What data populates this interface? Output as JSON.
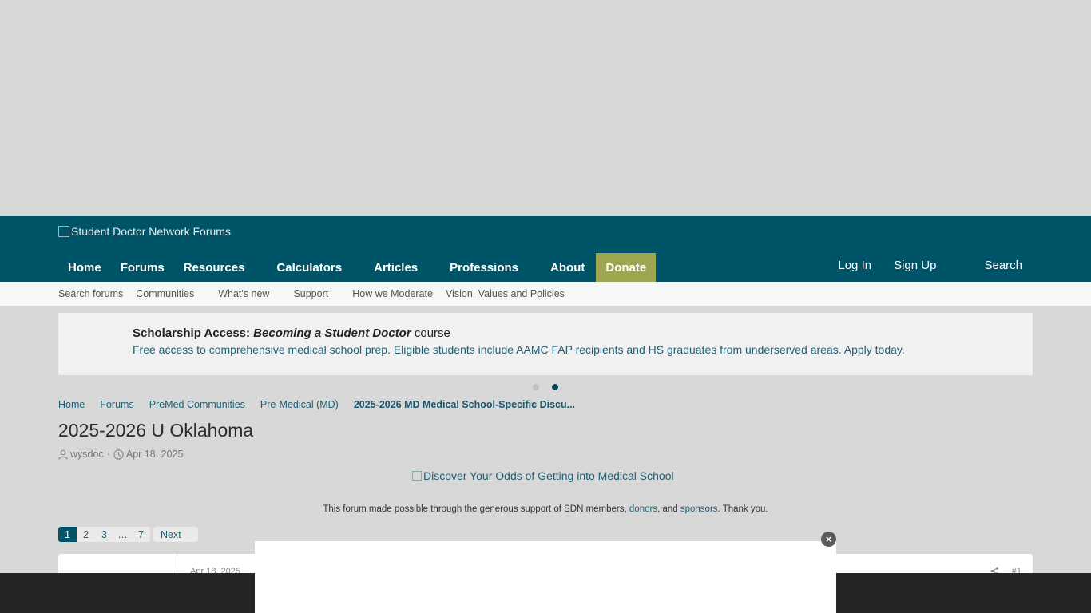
{
  "header": {
    "logo_alt": "Student Doctor Network Forums",
    "nav": [
      "Home",
      "Forums",
      "Resources",
      "Calculators",
      "Articles",
      "Professions",
      "About"
    ],
    "donate_label": "Donate",
    "login_label": "Log In",
    "signup_label": "Sign Up",
    "search_label": "Search"
  },
  "subnav": {
    "items": [
      "Search forums",
      "Communities",
      "What's new",
      "Support",
      "How we Moderate",
      "Vision, Values and Policies"
    ]
  },
  "notice": {
    "title_prefix": "Scholarship Access: ",
    "title_emphasis": "Becoming a Student Doctor",
    "title_suffix": " course",
    "description": "Free access to comprehensive medical school prep. Eligible students include AAMC FAP recipients and HS graduates from underserved areas. Apply today.",
    "slide_count": 2,
    "active_slide": 2
  },
  "breadcrumb": [
    "Home",
    "Forums",
    "PreMed Communities",
    "Pre-Medical (MD)",
    "2025-2026 MD Medical School-Specific Discu..."
  ],
  "thread": {
    "title": "2025-2026 U Oklahoma",
    "author": "wysdoc",
    "date": "Apr 18, 2025",
    "meta_sep": "·"
  },
  "discover_alt": "Discover Your Odds of Getting into Medical School",
  "support": {
    "text_before": "This forum made possible through the generous support of SDN members, ",
    "donors": "donors",
    "text_middle": ", and ",
    "sponsors": "sponsors",
    "text_after": ". Thank you."
  },
  "pager": {
    "pages": [
      "1",
      "2",
      "3",
      "…",
      "7"
    ],
    "current": "1",
    "next_label": "Next"
  },
  "post": {
    "date": "Apr 18, 2025",
    "number": "#1"
  },
  "ad": {
    "close_glyph": "×"
  },
  "colors": {
    "header_bg": "#005468",
    "donate_bg": "#9ea74f",
    "link": "#1f5f73"
  }
}
